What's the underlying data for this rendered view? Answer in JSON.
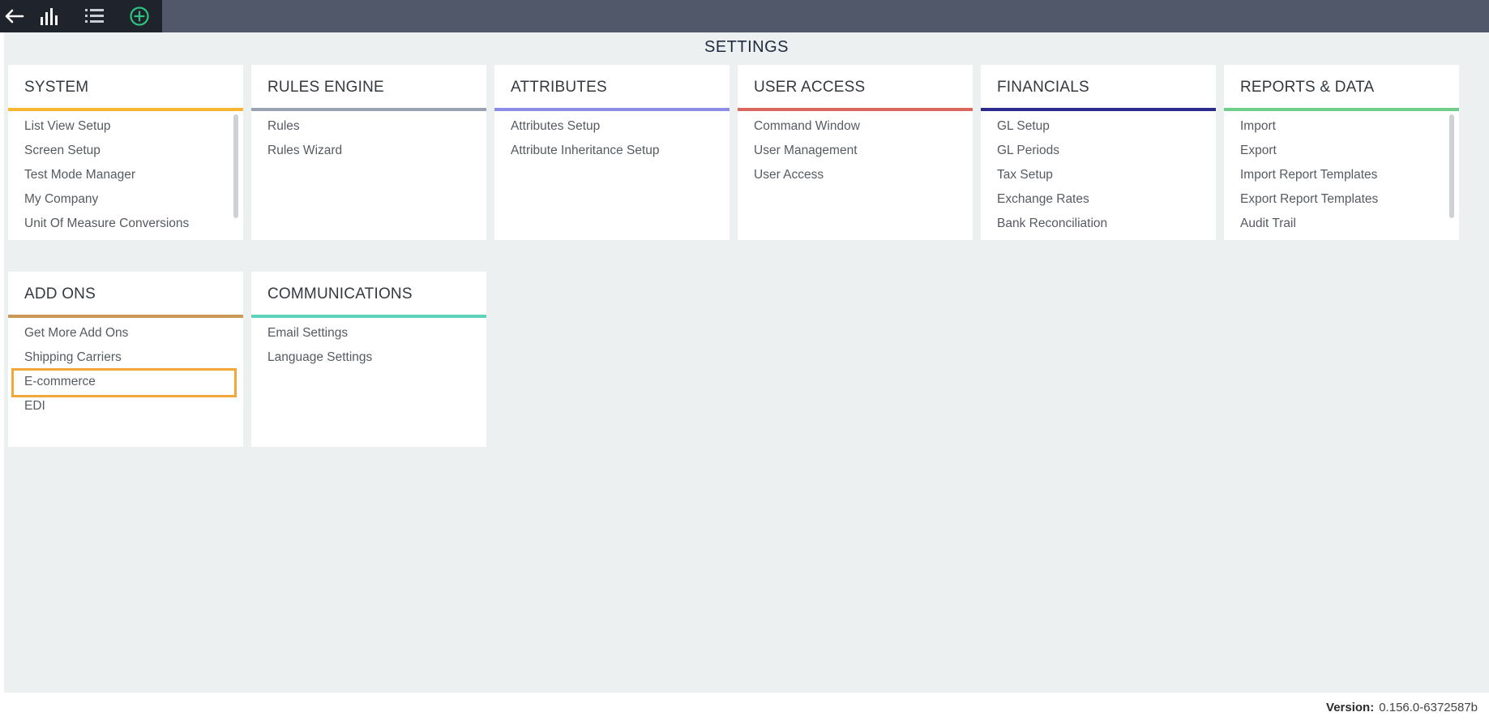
{
  "toolbar": {
    "back_icon": "arrow-left-icon",
    "chart_icon": "bar-chart-icon",
    "list_icon": "list-icon",
    "add_icon": "plus-circle-icon",
    "add_color": "#2ec27e"
  },
  "page": {
    "title": "SETTINGS"
  },
  "cards": {
    "system": {
      "title": "SYSTEM",
      "accent": "#f7b731",
      "items": [
        "List View Setup",
        "Screen Setup",
        "Test Mode Manager",
        "My Company",
        "Unit Of Measure Conversions"
      ]
    },
    "rules_engine": {
      "title": "RULES ENGINE",
      "accent": "#99a3b4",
      "items": [
        "Rules",
        "Rules Wizard"
      ]
    },
    "attributes": {
      "title": "ATTRIBUTES",
      "accent": "#8c8de8",
      "items": [
        "Attributes Setup",
        "Attribute Inheritance Setup"
      ]
    },
    "user_access": {
      "title": "USER ACCESS",
      "accent": "#d9675c",
      "items": [
        "Command Window",
        "User Management",
        "User Access"
      ]
    },
    "financials": {
      "title": "FINANCIALS",
      "accent": "#2c2c8f",
      "items": [
        "GL Setup",
        "GL Periods",
        "Tax Setup",
        "Exchange Rates",
        "Bank Reconciliation"
      ]
    },
    "reports_data": {
      "title": "REPORTS & DATA",
      "accent": "#6fcf8a",
      "items": [
        "Import",
        "Export",
        "Import Report Templates",
        "Export Report Templates",
        "Audit Trail"
      ]
    },
    "add_ons": {
      "title": "ADD ONS",
      "accent": "#cc9a58",
      "items": [
        "Get More Add Ons",
        "Shipping Carriers",
        "E-commerce",
        "EDI"
      ]
    },
    "communications": {
      "title": "COMMUNICATIONS",
      "accent": "#5fd3b9",
      "items": [
        "Email Settings",
        "Language Settings"
      ]
    }
  },
  "footer": {
    "version_label": "Version:",
    "version_value": "0.156.0-6372587b"
  }
}
